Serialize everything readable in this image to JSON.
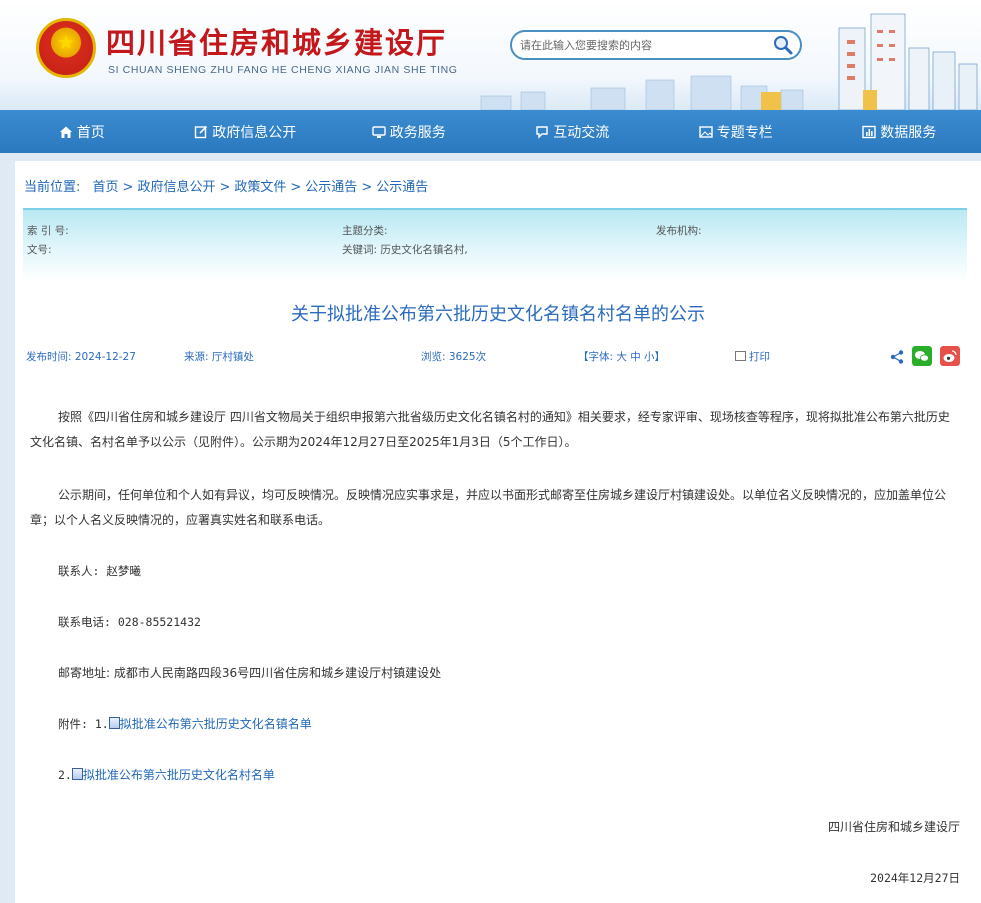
{
  "header": {
    "title": "四川省住房和城乡建设厅",
    "pinyin": "SI CHUAN SHENG ZHU FANG HE CHENG XIANG JIAN SHE TING",
    "search_placeholder": "请在此输入您要搜索的内容"
  },
  "nav": {
    "items": [
      {
        "label": "首页",
        "icon": "home-icon"
      },
      {
        "label": "政府信息公开",
        "icon": "edit-icon"
      },
      {
        "label": "政务服务",
        "icon": "monitor-icon"
      },
      {
        "label": "互动交流",
        "icon": "chat-icon"
      },
      {
        "label": "专题专栏",
        "icon": "image-icon"
      },
      {
        "label": "数据服务",
        "icon": "chart-icon"
      }
    ]
  },
  "breadcrumb": {
    "prefix": "当前位置:",
    "items": [
      "首页",
      "政府信息公开",
      "政策文件",
      "公示通告",
      "公示通告"
    ]
  },
  "meta": {
    "index_label": "索 引 号:",
    "category_label": "主题分类:",
    "publisher_label": "发布机构:",
    "docno_label": "文号:",
    "keywords": "关键词:  历史文化名镇名村,"
  },
  "article": {
    "title": "关于拟批准公布第六批历史文化名镇名村名单的公示",
    "publish_time": "发布时间: 2024-12-27",
    "source": "来源: 厅村镇处",
    "views": "浏览: 3625次",
    "font_size": "【字体: 大 中 小】",
    "print": "打印",
    "paragraph1": "按照《四川省住房和城乡建设厅 四川省文物局关于组织申报第六批省级历史文化名镇名村的通知》相关要求，经专家评审、现场核查等程序，现将拟批准公布第六批历史文化名镇、名村名单予以公示（见附件）。公示期为2024年12月27日至2025年1月3日（5个工作日）。",
    "paragraph2": "公示期间，任何单位和个人如有异议，均可反映情况。反映情况应实事求是，并应以书面形式邮寄至住房城乡建设厅村镇建设处。以单位名义反映情况的，应加盖单位公章；以个人名义反映情况的，应署真实姓名和联系电话。",
    "contact": "联系人: 赵梦曦",
    "phone": "联系电话: 028-85521432",
    "address": "邮寄地址: 成都市人民南路四段36号四川省住房和城乡建设厅村镇建设处",
    "attach_prefix": "附件: 1.",
    "attachment1": "拟批准公布第六批历史文化名镇名单",
    "attach2_prefix": "2.",
    "attachment2": "拟批准公布第六批历史文化名村名单",
    "signature": "四川省住房和城乡建设厅",
    "date": "2024年12月27日"
  },
  "colors": {
    "brand_red": "#c4171b",
    "nav_blue": "#2b78bf",
    "link_blue": "#2268b8",
    "wechat_green": "#2aae2a",
    "weibo_red": "#e8504a"
  }
}
